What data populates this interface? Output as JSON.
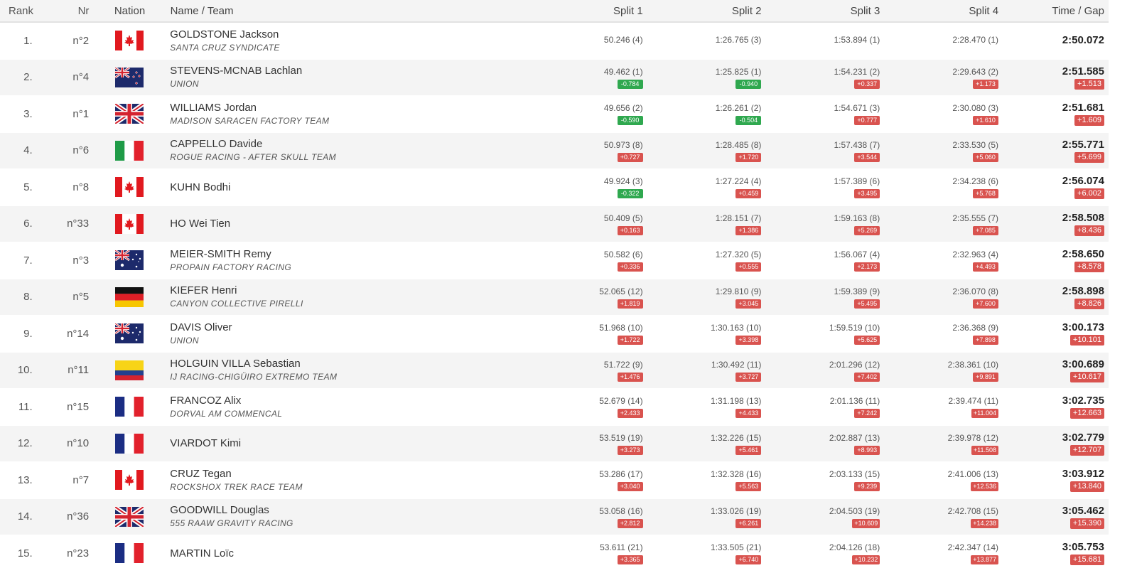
{
  "headers": {
    "rank": "Rank",
    "nr": "Nr",
    "nation": "Nation",
    "name": "Name / Team",
    "split1": "Split 1",
    "split2": "Split 2",
    "split3": "Split 3",
    "split4": "Split 4",
    "time": "Time / Gap"
  },
  "rows": [
    {
      "rank": "1.",
      "nr": "n°2",
      "flag": "canada",
      "name": "GOLDSTONE Jackson",
      "team": "SANTA CRUZ SYNDICATE",
      "s1": "50.246 (4)",
      "d1": "",
      "s2": "1:26.765 (3)",
      "d2": "",
      "s3": "1:53.894 (1)",
      "d3": "",
      "s4": "2:28.470 (1)",
      "d4": "",
      "time": "2:50.072",
      "gap": ""
    },
    {
      "rank": "2.",
      "nr": "n°4",
      "flag": "new-zealand",
      "name": "STEVENS-MCNAB Lachlan",
      "team": "UNION",
      "s1": "49.462 (1)",
      "d1": "-0.784",
      "s2": "1:25.825 (1)",
      "d2": "-0.940",
      "s3": "1:54.231 (2)",
      "d3": "+0.337",
      "s4": "2:29.643 (2)",
      "d4": "+1.173",
      "time": "2:51.585",
      "gap": "+1.513"
    },
    {
      "rank": "3.",
      "nr": "n°1",
      "flag": "uk",
      "name": "WILLIAMS Jordan",
      "team": "MADISON SARACEN FACTORY TEAM",
      "s1": "49.656 (2)",
      "d1": "-0.590",
      "s2": "1:26.261 (2)",
      "d2": "-0.504",
      "s3": "1:54.671 (3)",
      "d3": "+0.777",
      "s4": "2:30.080 (3)",
      "d4": "+1.610",
      "time": "2:51.681",
      "gap": "+1.609"
    },
    {
      "rank": "4.",
      "nr": "n°6",
      "flag": "italy",
      "name": "CAPPELLO Davide",
      "team": "ROGUE RACING - AFTER SKULL TEAM",
      "s1": "50.973 (8)",
      "d1": "+0.727",
      "s2": "1:28.485 (8)",
      "d2": "+1.720",
      "s3": "1:57.438 (7)",
      "d3": "+3.544",
      "s4": "2:33.530 (5)",
      "d4": "+5.060",
      "time": "2:55.771",
      "gap": "+5.699"
    },
    {
      "rank": "5.",
      "nr": "n°8",
      "flag": "canada",
      "name": "KUHN Bodhi",
      "team": "",
      "s1": "49.924 (3)",
      "d1": "-0.322",
      "s2": "1:27.224 (4)",
      "d2": "+0.459",
      "s3": "1:57.389 (6)",
      "d3": "+3.495",
      "s4": "2:34.238 (6)",
      "d4": "+5.768",
      "time": "2:56.074",
      "gap": "+6.002"
    },
    {
      "rank": "6.",
      "nr": "n°33",
      "flag": "canada",
      "name": "HO Wei Tien",
      "team": "",
      "s1": "50.409 (5)",
      "d1": "+0.163",
      "s2": "1:28.151 (7)",
      "d2": "+1.386",
      "s3": "1:59.163 (8)",
      "d3": "+5.269",
      "s4": "2:35.555 (7)",
      "d4": "+7.085",
      "time": "2:58.508",
      "gap": "+8.436"
    },
    {
      "rank": "7.",
      "nr": "n°3",
      "flag": "australia",
      "name": "MEIER-SMITH Remy",
      "team": "PROPAIN FACTORY RACING",
      "s1": "50.582 (6)",
      "d1": "+0.336",
      "s2": "1:27.320 (5)",
      "d2": "+0.555",
      "s3": "1:56.067 (4)",
      "d3": "+2.173",
      "s4": "2:32.963 (4)",
      "d4": "+4.493",
      "time": "2:58.650",
      "gap": "+8.578"
    },
    {
      "rank": "8.",
      "nr": "n°5",
      "flag": "germany",
      "name": "KIEFER Henri",
      "team": "CANYON COLLECTIVE PIRELLI",
      "s1": "52.065 (12)",
      "d1": "+1.819",
      "s2": "1:29.810 (9)",
      "d2": "+3.045",
      "s3": "1:59.389 (9)",
      "d3": "+5.495",
      "s4": "2:36.070 (8)",
      "d4": "+7.600",
      "time": "2:58.898",
      "gap": "+8.826"
    },
    {
      "rank": "9.",
      "nr": "n°14",
      "flag": "australia",
      "name": "DAVIS Oliver",
      "team": "UNION",
      "s1": "51.968 (10)",
      "d1": "+1.722",
      "s2": "1:30.163 (10)",
      "d2": "+3.398",
      "s3": "1:59.519 (10)",
      "d3": "+5.625",
      "s4": "2:36.368 (9)",
      "d4": "+7.898",
      "time": "3:00.173",
      "gap": "+10.101"
    },
    {
      "rank": "10.",
      "nr": "n°11",
      "flag": "colombia",
      "name": "HOLGUIN VILLA Sebastian",
      "team": "IJ RACING-CHIGÜIRO EXTREMO TEAM",
      "s1": "51.722 (9)",
      "d1": "+1.476",
      "s2": "1:30.492 (11)",
      "d2": "+3.727",
      "s3": "2:01.296 (12)",
      "d3": "+7.402",
      "s4": "2:38.361 (10)",
      "d4": "+9.891",
      "time": "3:00.689",
      "gap": "+10.617"
    },
    {
      "rank": "11.",
      "nr": "n°15",
      "flag": "france",
      "name": "FRANCOZ Alix",
      "team": "DORVAL AM COMMENCAL",
      "s1": "52.679 (14)",
      "d1": "+2.433",
      "s2": "1:31.198 (13)",
      "d2": "+4.433",
      "s3": "2:01.136 (11)",
      "d3": "+7.242",
      "s4": "2:39.474 (11)",
      "d4": "+11.004",
      "time": "3:02.735",
      "gap": "+12.663"
    },
    {
      "rank": "12.",
      "nr": "n°10",
      "flag": "france",
      "name": "VIARDOT Kimi",
      "team": "",
      "s1": "53.519 (19)",
      "d1": "+3.273",
      "s2": "1:32.226 (15)",
      "d2": "+5.461",
      "s3": "2:02.887 (13)",
      "d3": "+8.993",
      "s4": "2:39.978 (12)",
      "d4": "+11.508",
      "time": "3:02.779",
      "gap": "+12.707"
    },
    {
      "rank": "13.",
      "nr": "n°7",
      "flag": "canada",
      "name": "CRUZ Tegan",
      "team": "ROCKSHOX TREK RACE TEAM",
      "s1": "53.286 (17)",
      "d1": "+3.040",
      "s2": "1:32.328 (16)",
      "d2": "+5.563",
      "s3": "2:03.133 (15)",
      "d3": "+9.239",
      "s4": "2:41.006 (13)",
      "d4": "+12.536",
      "time": "3:03.912",
      "gap": "+13.840"
    },
    {
      "rank": "14.",
      "nr": "n°36",
      "flag": "uk",
      "name": "GOODWILL Douglas",
      "team": "555 RAAW GRAVITY RACING",
      "s1": "53.058 (16)",
      "d1": "+2.812",
      "s2": "1:33.026 (19)",
      "d2": "+6.261",
      "s3": "2:04.503 (19)",
      "d3": "+10.609",
      "s4": "2:42.708 (15)",
      "d4": "+14.238",
      "time": "3:05.462",
      "gap": "+15.390"
    },
    {
      "rank": "15.",
      "nr": "n°23",
      "flag": "france",
      "name": "MARTIN Loïc",
      "team": "",
      "s1": "53.611 (21)",
      "d1": "+3.365",
      "s2": "1:33.505 (21)",
      "d2": "+6.740",
      "s3": "2:04.126 (18)",
      "d3": "+10.232",
      "s4": "2:42.347 (14)",
      "d4": "+13.877",
      "time": "3:05.753",
      "gap": "+15.681"
    }
  ]
}
